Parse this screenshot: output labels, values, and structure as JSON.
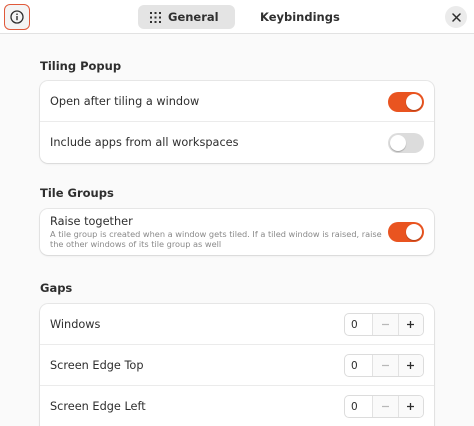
{
  "header": {
    "tabs": [
      {
        "label": "General",
        "icon": "grid-icon",
        "active": true
      },
      {
        "label": "Keybindings",
        "icon": "keyboard-icon",
        "active": false
      }
    ]
  },
  "sections": {
    "tiling_popup": {
      "title": "Tiling Popup",
      "rows": [
        {
          "label": "Open after tiling a window",
          "enabled": true
        },
        {
          "label": "Include apps from all workspaces",
          "enabled": false
        }
      ]
    },
    "tile_groups": {
      "title": "Tile Groups",
      "rows": [
        {
          "label": "Raise together",
          "subtitle": "A tile group is created when a window gets tiled. If a tiled window is raised, raise the other windows of its tile group as well",
          "enabled": true
        }
      ]
    },
    "gaps": {
      "title": "Gaps",
      "rows": [
        {
          "label": "Windows",
          "value": "0"
        },
        {
          "label": "Screen Edge Top",
          "value": "0"
        },
        {
          "label": "Screen Edge Left",
          "value": "0"
        }
      ]
    }
  },
  "colors": {
    "accent": "#e95420",
    "switch_off": "#dcdcdc",
    "focus_ring": "#e0593a"
  }
}
